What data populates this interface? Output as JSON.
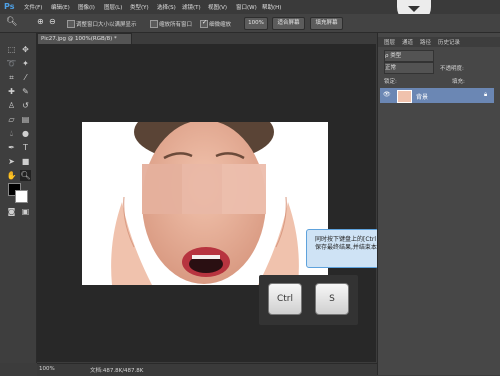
{
  "app": {
    "logo": "Ps"
  },
  "menu": [
    "文件(F)",
    "编辑(E)",
    "图像(I)",
    "图层(L)",
    "类型(Y)",
    "选择(S)",
    "滤镜(T)",
    "视图(V)",
    "窗口(W)",
    "帮助(H)"
  ],
  "options": {
    "resize_label": "调整窗口大小以满屏显示",
    "zoom_all_label": "缩放所有窗口",
    "scrubby_label": "细微缩放",
    "zoom_value": "100%",
    "fit_screen": "适合屏幕",
    "fill_screen": "填充屏幕"
  },
  "document": {
    "tab_label": "Pic27.jpg @ 100%(RGB/8) *",
    "zoom": "100%",
    "doc_info": "文档:487.8K/487.8K"
  },
  "panels": {
    "tabs": [
      "图层",
      "通道",
      "路径",
      "历史记录"
    ],
    "kind_label": "ρ 类型",
    "blend_mode": "正常",
    "opacity_label": "不透明度:",
    "lock_label": "锁定:",
    "fill_label": "填充:",
    "layer_name": "背景"
  },
  "callout": {
    "line1": "同时按下键盘上的[Ctrl + S]快捷键,",
    "line2": "保存最终结果,并结束本节课程。"
  },
  "keys": {
    "ctrl": "Ctrl",
    "s": "S"
  },
  "colors": {
    "canvas_bg": "#282828",
    "panel_bg": "#474747",
    "callout_bg": "#cfe3f5",
    "layer_highlight": "#6b87b4"
  }
}
